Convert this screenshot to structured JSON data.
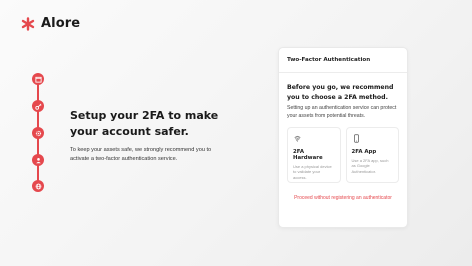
{
  "brand": {
    "name": "Alore",
    "logo_icon": "asterisk-logo-icon",
    "accent": "#e5484d"
  },
  "steps": [
    {
      "icon": "calendar-icon"
    },
    {
      "icon": "key-icon"
    },
    {
      "icon": "gear-icon"
    },
    {
      "icon": "user-icon"
    },
    {
      "icon": "globe-icon"
    }
  ],
  "hero": {
    "title": "Setup your 2FA to make your account safer.",
    "description": "To keep your assets safe, we strongly recommend you to activate a two-factor authentication service."
  },
  "card": {
    "header": "Two-Factor Authentication",
    "heading": "Before you go, we recommend you to choose a 2FA method.",
    "subtext": "Setting up an authentication service can protect your assets from potential threats.",
    "options": [
      {
        "icon": "fingerprint-icon",
        "title": "2FA Hardware",
        "description": "Use a physical device to validate your access."
      },
      {
        "icon": "smartphone-icon",
        "title": "2FA App",
        "description": "Use a 2FA app, such as Google Authenticator."
      }
    ],
    "skip_link": "Proceed without registering an authenticator"
  }
}
